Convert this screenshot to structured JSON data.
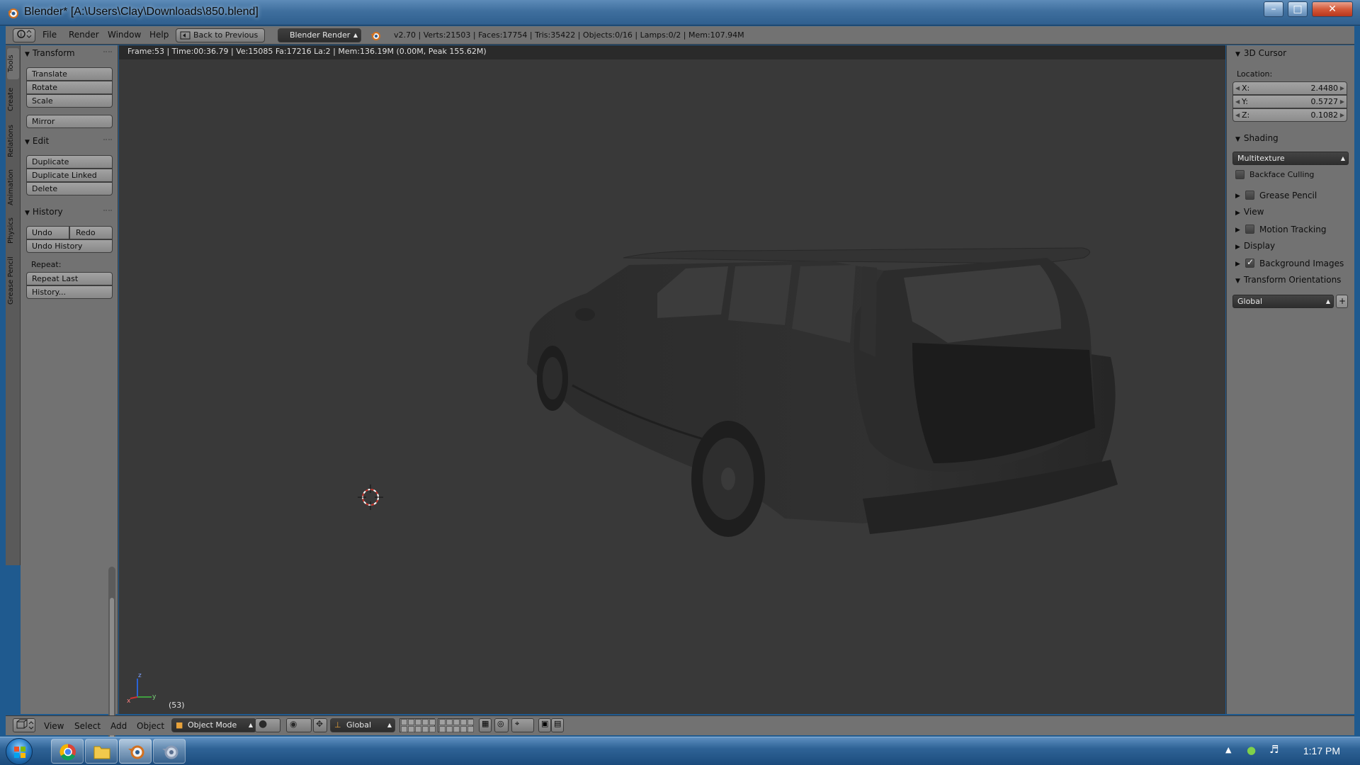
{
  "window": {
    "title": "Blender* [A:\\Users\\Clay\\Downloads\\850.blend]",
    "minimize_glyph": "–",
    "maximize_glyph": "□",
    "close_glyph": "✕"
  },
  "top_header": {
    "menus": [
      "File",
      "Render",
      "Window",
      "Help"
    ],
    "back_button": "Back to Previous",
    "render_engine": "Blender Render",
    "stats": "v2.70 | Verts:21503 | Faces:17754 | Tris:35422 | Objects:0/16 | Lamps:0/2 | Mem:107.94M"
  },
  "tool_tabs": [
    "Tools",
    "Create",
    "Relations",
    "Animation",
    "Physics",
    "Grease Pencil"
  ],
  "tool_shelf": {
    "transform": {
      "title": "Transform",
      "buttons": [
        "Translate",
        "Rotate",
        "Scale"
      ],
      "mirror": "Mirror"
    },
    "edit": {
      "title": "Edit",
      "buttons": [
        "Duplicate",
        "Duplicate Linked",
        "Delete"
      ]
    },
    "history": {
      "title": "History",
      "undo": "Undo",
      "redo": "Redo",
      "undo_history": "Undo History",
      "repeat_label": "Repeat:",
      "repeat_last": "Repeat Last",
      "history_btn": "History..."
    }
  },
  "viewport": {
    "info": "Frame:53 | Time:00:36.79 | Ve:15085 Fa:17216 La:2 | Mem:136.19M (0.00M, Peak 155.62M)",
    "frame_label": "(53)",
    "axis_x": "x",
    "axis_y": "y",
    "axis_z": "z"
  },
  "properties": {
    "cursor": {
      "title": "3D Cursor",
      "location_label": "Location:",
      "x_label": "X:",
      "x": "2.4480",
      "y_label": "Y:",
      "y": "0.5727",
      "z_label": "Z:",
      "z": "0.1082"
    },
    "shading": {
      "title": "Shading",
      "mode": "Multitexture",
      "backface": "Backface Culling"
    },
    "collapsed": {
      "grease_pencil": "Grease Pencil",
      "view": "View",
      "motion_tracking": "Motion Tracking",
      "display": "Display",
      "background_images": "Background Images"
    },
    "orientations": {
      "title": "Transform Orientations",
      "value": "Global"
    }
  },
  "bottom_header": {
    "menus": [
      "View",
      "Select",
      "Add",
      "Object"
    ],
    "mode": "Object Mode",
    "orientation": "Global"
  },
  "taskbar": {
    "clock": "1:17 PM"
  },
  "colors": {
    "viewport_bg": "#393939",
    "panel_bg": "#727272",
    "car_body": "#2a2a2a",
    "cursor_red": "#c8362e"
  }
}
